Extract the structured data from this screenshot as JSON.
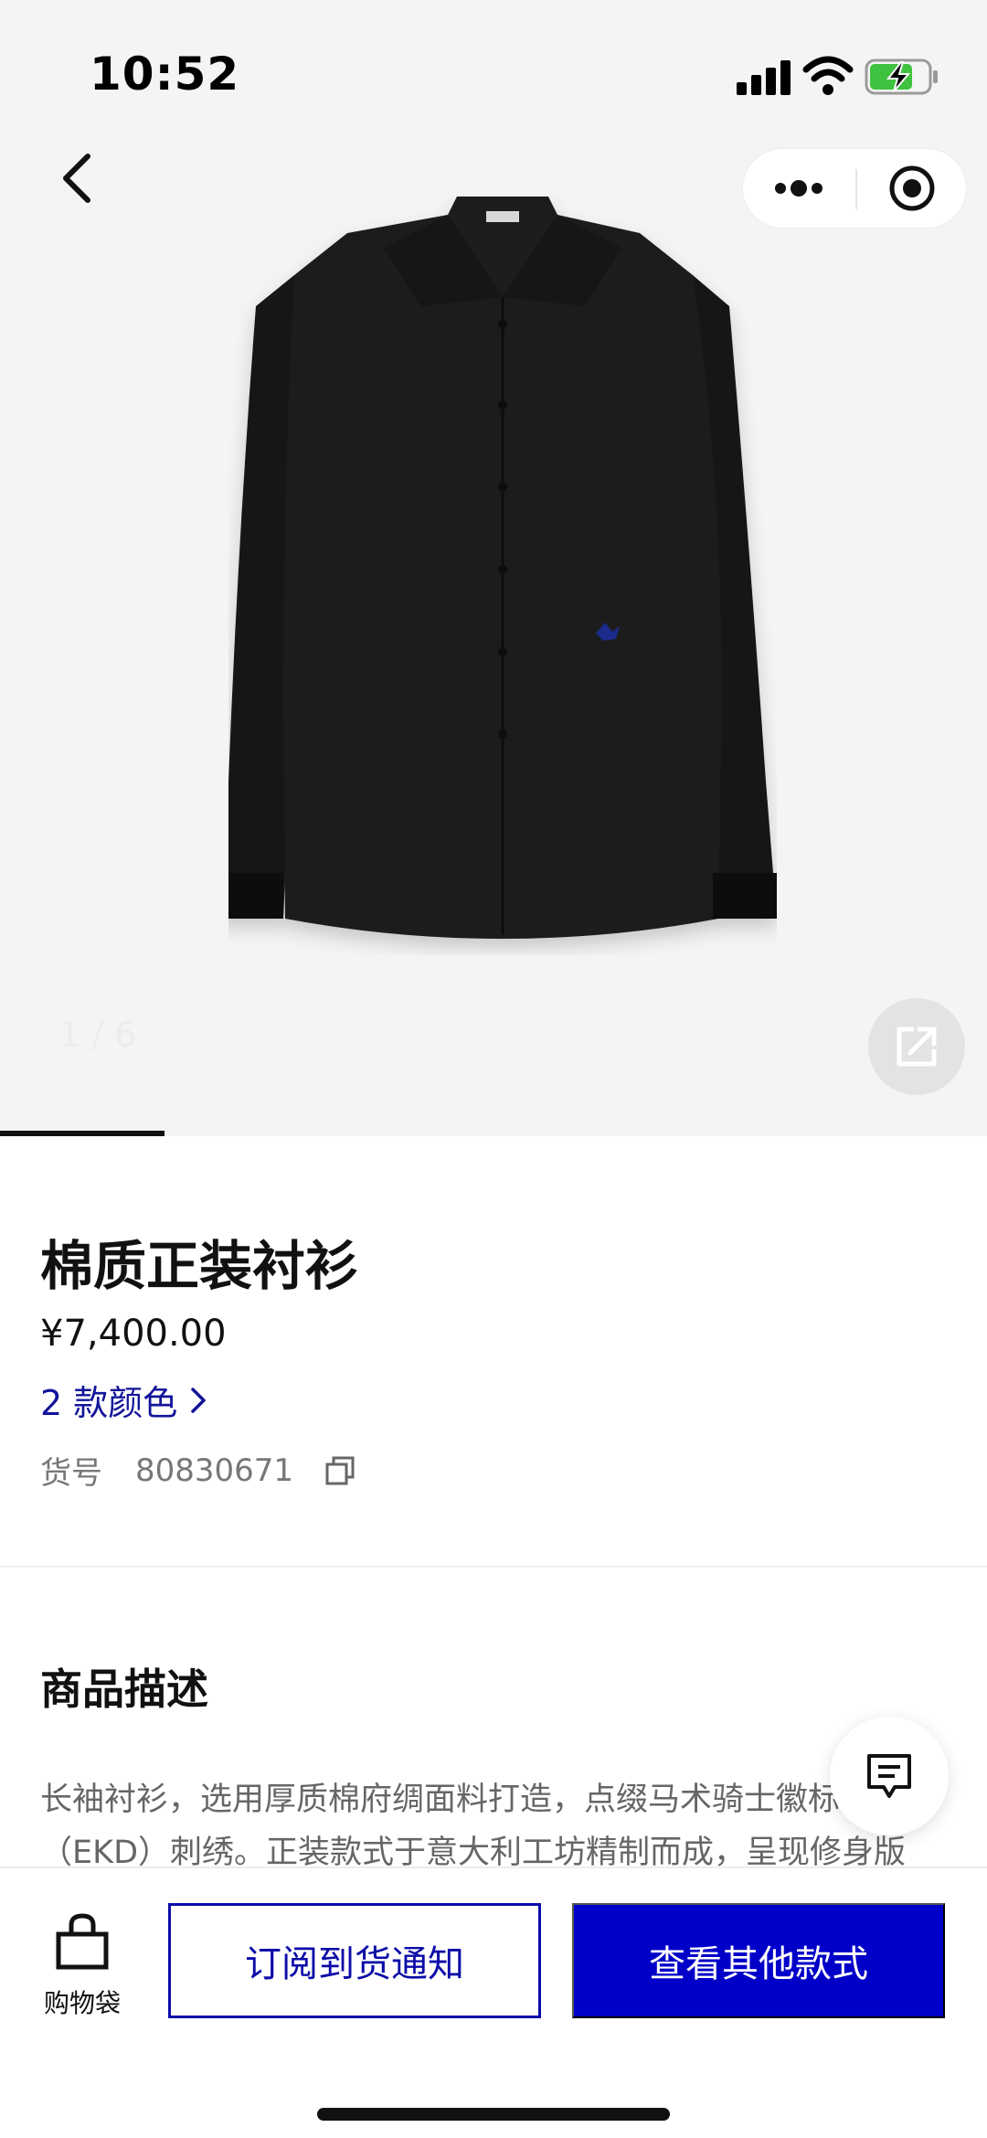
{
  "status_bar": {
    "time": "10:52"
  },
  "gallery": {
    "current": "1",
    "total": "6",
    "counter_text": "1 / 6",
    "progress_fraction": 0.1667
  },
  "product": {
    "title": "棉质正装衬衫",
    "price": "¥7,400.00",
    "colors_link": "2 款颜色",
    "sku_label": "货号",
    "sku_value": "80830671"
  },
  "description": {
    "heading": "商品描述",
    "text": "长袖衬衫，选用厚质棉府绸面料打造，点缀马术骑士徽标（EKD）刺绣。正装款式于意大利工坊精制而成，呈现修身版"
  },
  "bottom_bar": {
    "bag_label": "购物袋",
    "subscribe_label": "订阅到货通知",
    "other_styles_label": "查看其他款式"
  },
  "colors": {
    "brand_blue": "#0000c8",
    "link_blue": "#12149a"
  },
  "icons": [
    "back-icon",
    "more-dots-icon",
    "close-target-icon",
    "share-icon",
    "chevron-right-icon",
    "copy-icon",
    "chat-icon",
    "shopping-bag-icon"
  ]
}
